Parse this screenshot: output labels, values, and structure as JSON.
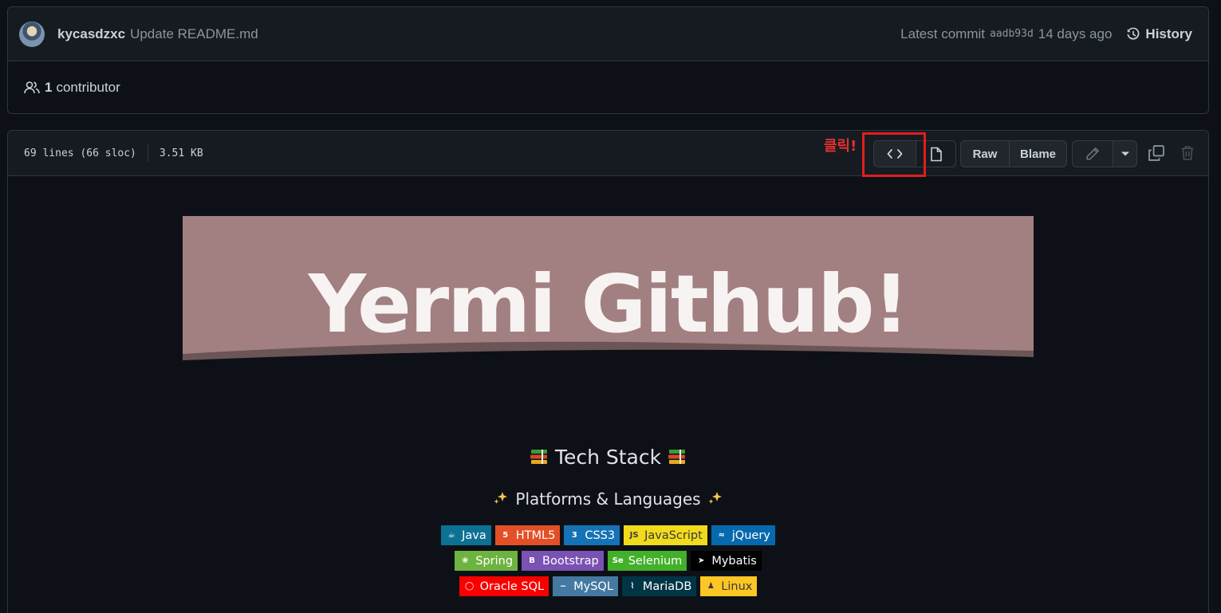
{
  "commit": {
    "author": "kycasdzxc",
    "message": "Update README.md",
    "latest_label": "Latest commit",
    "sha": "aadb93d",
    "time": "14 days ago",
    "history_label": "History"
  },
  "contributors": {
    "count": "1",
    "label": "contributor"
  },
  "file": {
    "lines": "69 lines (66 sloc)",
    "size": "3.51 KB",
    "raw_label": "Raw",
    "blame_label": "Blame",
    "annotation": "클릭!"
  },
  "readme": {
    "banner_title": "Yermi Github!",
    "tech_heading": "Tech Stack",
    "platform_heading": "Platforms & Languages",
    "badge_rows": [
      [
        {
          "label": "Java",
          "color": "#0d7194",
          "icon": "java-icon"
        },
        {
          "label": "HTML5",
          "color": "#e34f26",
          "icon": "html5-icon"
        },
        {
          "label": "CSS3",
          "color": "#1572b6",
          "icon": "css3-icon"
        },
        {
          "label": "JavaScript",
          "color": "#f0db1c",
          "icon": "javascript-icon",
          "text_color": "#3a3a3a"
        },
        {
          "label": "jQuery",
          "color": "#0769ad",
          "icon": "jquery-icon"
        }
      ],
      [
        {
          "label": "Spring",
          "color": "#6db33f",
          "icon": "spring-icon"
        },
        {
          "label": "Bootstrap",
          "color": "#7952b3",
          "icon": "bootstrap-icon"
        },
        {
          "label": "Selenium",
          "color": "#43b02a",
          "icon": "selenium-icon"
        },
        {
          "label": "Mybatis",
          "color": "#000000",
          "icon": "mybatis-icon"
        }
      ],
      [
        {
          "label": "Oracle SQL",
          "color": "#f80000",
          "icon": "oracle-icon"
        },
        {
          "label": "MySQL",
          "color": "#4479a1",
          "icon": "mysql-icon"
        },
        {
          "label": "MariaDB",
          "color": "#003545",
          "icon": "mariadb-icon"
        },
        {
          "label": "Linux",
          "color": "#fcc624",
          "icon": "linux-icon",
          "text_color": "#3a3a3a"
        }
      ]
    ]
  },
  "colors": {
    "background": "#0d1117",
    "header": "#161b22",
    "border": "#30363d",
    "annotation_red": "#e01e1e",
    "banner": "#a27f80"
  }
}
